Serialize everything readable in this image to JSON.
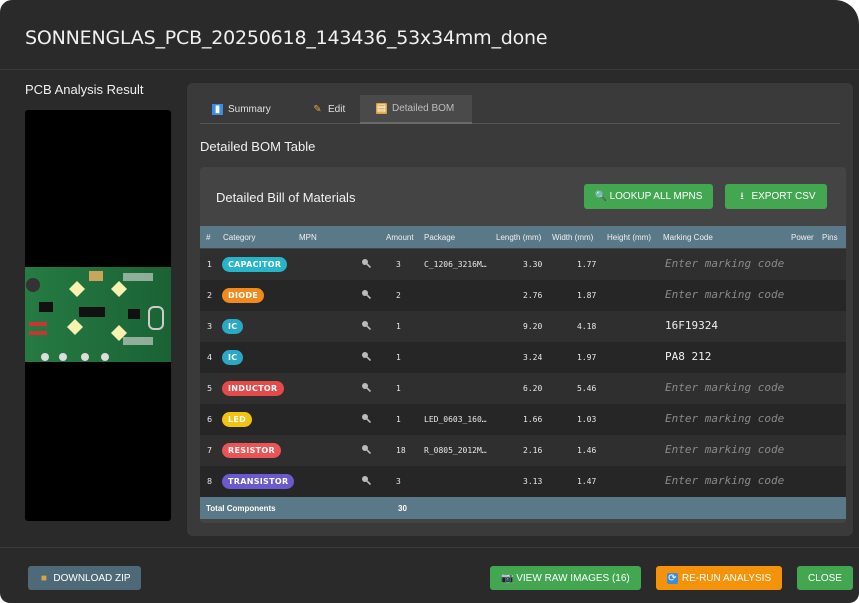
{
  "window": {
    "title": "SONNENGLAS_PCB_20250618_143436_53x34mm_done"
  },
  "left": {
    "label": "PCB Analysis Result"
  },
  "tabs": [
    {
      "label": "Summary",
      "icon": "chart-icon"
    },
    {
      "label": "Edit",
      "icon": "pencil-icon"
    },
    {
      "label": "Detailed BOM",
      "icon": "clipboard-icon",
      "active": true
    }
  ],
  "section": {
    "title": "Detailed BOM Table"
  },
  "bom": {
    "title": "Detailed Bill of Materials",
    "lookup_label": "LOOKUP ALL MPNS",
    "export_label": "EXPORT CSV",
    "columns": {
      "idx": "#",
      "category": "Category",
      "mpn": "MPN",
      "amount": "Amount",
      "package": "Package",
      "length": "Length (mm)",
      "width": "Width (mm)",
      "height": "Height (mm)",
      "marking": "Marking Code",
      "power": "Power",
      "pins": "Pins"
    },
    "rows": [
      {
        "idx": "1",
        "category": "CAPACITOR",
        "color": "#26b5c9",
        "amount": "3",
        "package": "C_1206_3216M…",
        "length": "3.30",
        "width": "1.77",
        "marking": "",
        "marking_placeholder": "Enter marking code"
      },
      {
        "idx": "2",
        "category": "DIODE",
        "color": "#f18a1c",
        "amount": "2",
        "package": "",
        "length": "2.76",
        "width": "1.87",
        "marking": "",
        "marking_placeholder": "Enter marking code"
      },
      {
        "idx": "3",
        "category": "IC",
        "color": "#2aa8c4",
        "amount": "1",
        "package": "",
        "length": "9.20",
        "width": "4.18",
        "marking": "16F19324",
        "marking_placeholder": ""
      },
      {
        "idx": "4",
        "category": "IC",
        "color": "#2aa8c4",
        "amount": "1",
        "package": "",
        "length": "3.24",
        "width": "1.97",
        "marking": "PA8   212",
        "marking_placeholder": ""
      },
      {
        "idx": "5",
        "category": "INDUCTOR",
        "color": "#e44a4a",
        "amount": "1",
        "package": "",
        "length": "6.20",
        "width": "5.46",
        "marking": "",
        "marking_placeholder": "Enter marking code"
      },
      {
        "idx": "6",
        "category": "LED",
        "color": "#f2c311",
        "amount": "1",
        "package": "LED_0603_160…",
        "length": "1.66",
        "width": "1.03",
        "marking": "",
        "marking_placeholder": "Enter marking code"
      },
      {
        "idx": "7",
        "category": "RESISTOR",
        "color": "#ea5454",
        "amount": "18",
        "package": "R_0805_2012M…",
        "length": "2.16",
        "width": "1.46",
        "marking": "",
        "marking_placeholder": "Enter marking code"
      },
      {
        "idx": "8",
        "category": "TRANSISTOR",
        "color": "#6a5acd",
        "amount": "3",
        "package": "",
        "length": "3.13",
        "width": "1.47",
        "marking": "",
        "marking_placeholder": "Enter marking code"
      }
    ],
    "total_label": "Total Components",
    "total_amount": "30"
  },
  "footer": {
    "download_label": "DOWNLOAD ZIP",
    "view_raw_label": "VIEW RAW IMAGES (16)",
    "rerun_label": "RE-RUN ANALYSIS",
    "close_label": "CLOSE"
  },
  "colors": {
    "accent_green": "#43a651",
    "accent_orange": "#f4930a",
    "header": "#5a7988"
  }
}
